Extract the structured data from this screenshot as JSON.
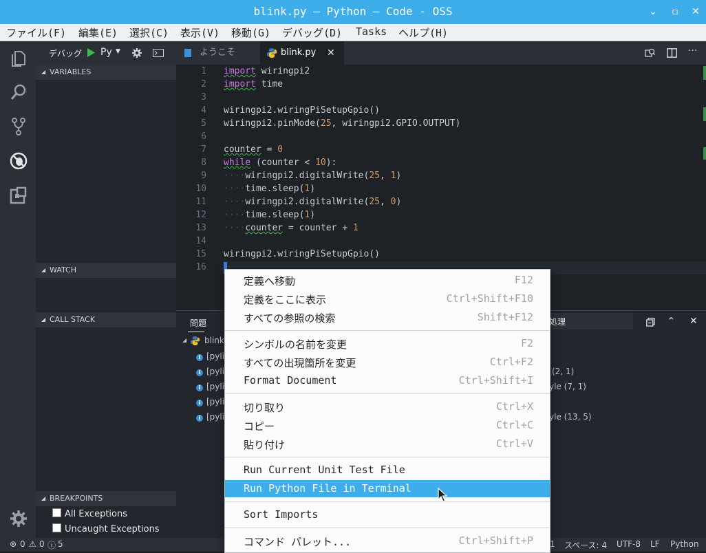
{
  "window": {
    "title": "blink.py — Python — Code - OSS",
    "controls": [
      "⌄",
      "▫",
      "✕"
    ]
  },
  "menubar": [
    "ファイル(F)",
    "編集(E)",
    "選択(C)",
    "表示(V)",
    "移動(G)",
    "デバッグ(D)",
    "Tasks",
    "ヘルプ(H)"
  ],
  "debug_toolbar": {
    "label": "デバッグ",
    "config": "Py"
  },
  "sidebar": {
    "sections": {
      "variables": "VARIABLES",
      "watch": "WATCH",
      "call_stack": "CALL STACK",
      "breakpoints": "BREAKPOINTS"
    },
    "breakpoints": [
      "All Exceptions",
      "Uncaught Exceptions"
    ]
  },
  "tabs": [
    {
      "label": "ようこそ"
    },
    {
      "label": "blink.py"
    }
  ],
  "editor": {
    "lines": [
      {
        "n": "1",
        "t": "import wiringpi2"
      },
      {
        "n": "2",
        "t": "import time"
      },
      {
        "n": "3",
        "t": ""
      },
      {
        "n": "4",
        "t": "wiringpi2.wiringPiSetupGpio()"
      },
      {
        "n": "5",
        "t": "wiringpi2.pinMode(25, wiringpi2.GPIO.OUTPUT)"
      },
      {
        "n": "6",
        "t": ""
      },
      {
        "n": "7",
        "t": "counter = 0"
      },
      {
        "n": "8",
        "t": "while (counter < 10):"
      },
      {
        "n": "9",
        "t": "    wiringpi2.digitalWrite(25, 1)"
      },
      {
        "n": "10",
        "t": "    time.sleep(1)"
      },
      {
        "n": "11",
        "t": "    wiringpi2.digitalWrite(25, 0)"
      },
      {
        "n": "12",
        "t": "    time.sleep(1)"
      },
      {
        "n": "13",
        "t": "    counter = counter + 1"
      },
      {
        "n": "14",
        "t": ""
      },
      {
        "n": "15",
        "t": "wiringpi2.wiringPiSetupGpio()"
      },
      {
        "n": "16",
        "t": ""
      }
    ]
  },
  "panel": {
    "tab": "問題",
    "filter_fragment": "処理",
    "file": "blink",
    "items": [
      {
        "left": "[pylir",
        "right": ""
      },
      {
        "left": "[pylir",
        "right": "(2, 1)"
      },
      {
        "left": "[pylir",
        "right": "yle (7, 1)"
      },
      {
        "left": "[pylir",
        "right": ""
      },
      {
        "left": "[pylir",
        "right": "yle (13, 5)"
      }
    ]
  },
  "context_menu": {
    "groups": [
      [
        {
          "label": "定義へ移動",
          "key": "F12"
        },
        {
          "label": "定義をここに表示",
          "key": "Ctrl+Shift+F10"
        },
        {
          "label": "すべての参照の検索",
          "key": "Shift+F12"
        }
      ],
      [
        {
          "label": "シンボルの名前を変更",
          "key": "F2"
        },
        {
          "label": "すべての出現箇所を変更",
          "key": "Ctrl+F2"
        },
        {
          "label": "Format Document",
          "key": "Ctrl+Shift+I"
        }
      ],
      [
        {
          "label": "切り取り",
          "key": "Ctrl+X"
        },
        {
          "label": "コピー",
          "key": "Ctrl+C"
        },
        {
          "label": "貼り付け",
          "key": "Ctrl+V"
        }
      ],
      [
        {
          "label": "Run Current Unit Test File",
          "key": ""
        },
        {
          "label": "Run Python File in Terminal",
          "key": ""
        }
      ],
      [
        {
          "label": "Sort Imports",
          "key": ""
        }
      ],
      [
        {
          "label": "コマンド パレット...",
          "key": "Ctrl+Shift+P"
        }
      ]
    ]
  },
  "statusbar": {
    "errors": "0",
    "warnings": "0",
    "infos": "5",
    "position_fragment": "1",
    "spaces": "スペース: 4",
    "encoding": "UTF-8",
    "eol": "LF",
    "language": "Python"
  },
  "colors": {
    "accent": "#3daee9",
    "keyword": "#c678dd",
    "number": "#d19a66",
    "sidebar_bg": "#23272d",
    "editor_bg": "#1e2227"
  }
}
